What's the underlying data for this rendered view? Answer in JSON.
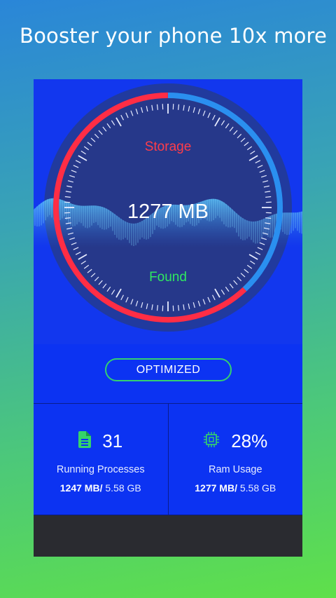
{
  "headline": "Booster your phone 10x more",
  "gauge": {
    "top_label": "Storage",
    "value": "1277 MB",
    "bottom_label": "Found",
    "used_color": "#ff2d45",
    "free_color": "#2a8ff0",
    "used_fraction": 0.62
  },
  "optimize_button": "OPTIMIZED",
  "stats": {
    "processes": {
      "icon": "document-icon",
      "count": "31",
      "label": "Running Processes",
      "used": "1247 MB/",
      "total": " 5.58 GB"
    },
    "ram": {
      "icon": "chip-icon",
      "percent": "28%",
      "label": "Ram Usage",
      "used": "1277 MB/",
      "total": " 5.58 GB"
    }
  }
}
